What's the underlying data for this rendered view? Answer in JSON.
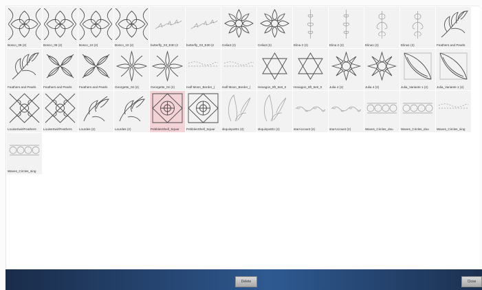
{
  "tiles": [
    {
      "label": "Bosco_08 (2)",
      "icon": "quad-petal"
    },
    {
      "label": "Bosco_08 (2)",
      "icon": "quad-petal"
    },
    {
      "label": "Bosco_10 (2)",
      "icon": "quad-petal"
    },
    {
      "label": "Bosco_10 (2)",
      "icon": "quad-petal"
    },
    {
      "label": "butterfly_03_E30 (2",
      "icon": "butterfly-border"
    },
    {
      "label": "butterfly_03_E30 (2",
      "icon": "butterfly-border"
    },
    {
      "label": "Celia3 (2)",
      "icon": "flower"
    },
    {
      "label": "Celia3 (2)",
      "icon": "flower"
    },
    {
      "label": "Elina 2 (2)",
      "icon": "vertical-vine"
    },
    {
      "label": "Elina 2 (2)",
      "icon": "vertical-vine"
    },
    {
      "label": "Elina1 (2)",
      "icon": "tall-vine"
    },
    {
      "label": "Elina1 (2)",
      "icon": "tall-vine"
    },
    {
      "label": "Feathers and Pearls",
      "icon": "feather"
    },
    {
      "label": "Feathers and Pearls",
      "icon": "feather"
    },
    {
      "label": "Feathers and Pearls",
      "icon": "feather-cross"
    },
    {
      "label": "Feathers and Pearls",
      "icon": "feather-cross"
    },
    {
      "label": "Georgette_02 (2)",
      "icon": "star-burst"
    },
    {
      "label": "Georgette_02 (2)",
      "icon": "star-burst"
    },
    {
      "label": "Half Moon_Border_(",
      "icon": "dotted-border"
    },
    {
      "label": "Half Moon_Border_(",
      "icon": "dotted-border"
    },
    {
      "label": "Hexagon_8ft_6x8_0",
      "icon": "hexagram"
    },
    {
      "label": "Hexagon_8ft_6x8_0",
      "icon": "hexagram"
    },
    {
      "label": "Julia 4 (2)",
      "icon": "octo-flower"
    },
    {
      "label": "Julia 4 (2)",
      "icon": "octo-flower"
    },
    {
      "label": "Julia_Variante 1 (2)",
      "icon": "diamond-leaf"
    },
    {
      "label": "Julia_Variante 1 (2)",
      "icon": "diamond-leaf"
    },
    {
      "label": "LouiseSwirlFeathers",
      "icon": "swirl-square"
    },
    {
      "label": "LouiseSwirlFeathers",
      "icon": "swirl-square"
    },
    {
      "label": "Lourdes (2)",
      "icon": "plume"
    },
    {
      "label": "Lourdes (2)",
      "icon": "plume"
    },
    {
      "label": "PebblesShell_Squar",
      "icon": "shell-square",
      "selected": true
    },
    {
      "label": "PebblesShell_Squar",
      "icon": "shell-square"
    },
    {
      "label": "skquinpot01 (2)",
      "icon": "leaf-outline"
    },
    {
      "label": "skquinpot01 (2)",
      "icon": "leaf-outline"
    },
    {
      "label": "starAccount (2)",
      "icon": "wave-border"
    },
    {
      "label": "starAccount (2)",
      "icon": "wave-border"
    },
    {
      "label": "Waves_Circles_dou",
      "icon": "circle-border"
    },
    {
      "label": "Waves_Circles_dou",
      "icon": "circle-border"
    },
    {
      "label": "Waves_Circles_sing",
      "icon": "dotted-border"
    },
    {
      "label": "Waves_Circles_sing",
      "icon": "circle-border"
    }
  ],
  "buttons": {
    "delete": "Delete",
    "close": "Close"
  },
  "colors": {
    "bar_left": "#1a2c4a",
    "bar_mid": "#2e5a92",
    "selected": "#f3d3d6"
  }
}
